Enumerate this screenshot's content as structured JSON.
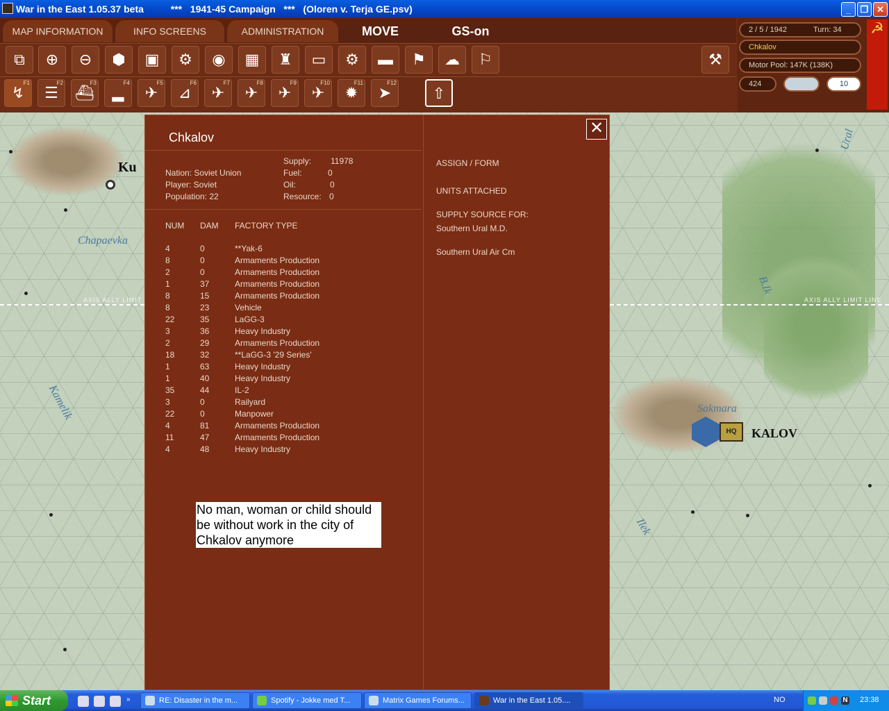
{
  "window": {
    "title": "War in the East 1.05.37 beta          ***   1941-45 Campaign   ***   (Oloren v. Terja GE.psv)",
    "minimize": "_",
    "maximize": "❐",
    "close": "✕"
  },
  "menu": {
    "map_information": "MAP INFORMATION",
    "info_screens": "INFO SCREENS",
    "administration": "ADMINISTRATION",
    "mode": "MOVE",
    "gs": "GS-on"
  },
  "toolbar_row1": [
    "overlay-icon",
    "zoom-in-icon",
    "zoom-out-icon",
    "hex-icon",
    "unit-icon",
    "gear-icon",
    "shape-icon",
    "chart-icon",
    "factory-icon",
    "rectangle-icon",
    "settings-icon",
    "tank-icon",
    "flag-arrow-icon",
    "weather-icon",
    "flag-icon"
  ],
  "toolbar_row2_keys": [
    "F1",
    "F2",
    "F3",
    "F4",
    "F5",
    "F6",
    "F7",
    "F8",
    "F9",
    "F10",
    "F11",
    "F12"
  ],
  "status": {
    "date": "2 / 5 / 1942",
    "turn": "Turn: 34",
    "location": "Chkalov",
    "motor_pool": "Motor Pool:  147K (138K)",
    "hex_count": "424",
    "weather_value": "10"
  },
  "colors": {
    "panel": "#6a2a12",
    "dialog": "#7a2c14",
    "map": "#c3d1bd",
    "river": "#4a7aa0"
  },
  "map": {
    "labels": [
      "Chapaevka",
      "Kamelik",
      "Ural",
      "B.Ik",
      "Sakmara",
      "Ilek"
    ],
    "city_left": "Ku",
    "city_right": "KALOV",
    "limit_text": "AXIS ALLY LIMIT",
    "limit_text_right": "AXIS ALLY LIMIT LINE",
    "unit_badge": "HQ"
  },
  "city": {
    "name": "Chkalov",
    "nation": "Nation: Soviet Union",
    "player": "Player: Soviet",
    "population": "Population: 22",
    "supply_label": "Supply:",
    "supply_value": "11978",
    "fuel_label": "Fuel:",
    "fuel_value": "0",
    "oil_label": "Oil:",
    "oil_value": "0",
    "resource_label": "Resource:",
    "resource_value": "0"
  },
  "factory_table": {
    "headers": [
      "NUM",
      "DAM",
      "FACTORY TYPE"
    ],
    "rows": [
      [
        "4",
        "0",
        "**Yak-6"
      ],
      [
        "8",
        "0",
        "Armaments Production"
      ],
      [
        "2",
        "0",
        "Armaments Production"
      ],
      [
        "1",
        "37",
        "Armaments Production"
      ],
      [
        "8",
        "15",
        "Armaments Production"
      ],
      [
        "8",
        "23",
        "Vehicle"
      ],
      [
        "22",
        "35",
        "LaGG-3"
      ],
      [
        "3",
        "36",
        "Heavy Industry"
      ],
      [
        "2",
        "29",
        "Armaments Production"
      ],
      [
        "18",
        "32",
        "**LaGG-3 '29 Series'"
      ],
      [
        "1",
        "63",
        "Heavy Industry"
      ],
      [
        "1",
        "40",
        "Heavy Industry"
      ],
      [
        "35",
        "44",
        "IL-2"
      ],
      [
        "3",
        "0",
        "Railyard"
      ],
      [
        "22",
        "0",
        "Manpower"
      ],
      [
        "4",
        "81",
        "Armaments Production"
      ],
      [
        "11",
        "47",
        "Armaments Production"
      ],
      [
        "4",
        "48",
        "Heavy Industry"
      ]
    ]
  },
  "actions": {
    "assign_form": "ASSIGN / FORM",
    "units_attached": "UNITS ATTACHED",
    "supply_source_for": "SUPPLY SOURCE FOR:",
    "supply_targets": [
      "Southern Ural M.D.",
      "Southern Ural Air Cm"
    ]
  },
  "note": "No man, woman or child should be without work in the city of Chkalov anymore",
  "taskbar": {
    "start": "Start",
    "tasks": [
      "RE: Disaster in the m...",
      "Spotify - Jokke med T...",
      "Matrix Games Forums...",
      "War in the East 1.05...."
    ],
    "language": "NO",
    "clock": "23:38"
  }
}
